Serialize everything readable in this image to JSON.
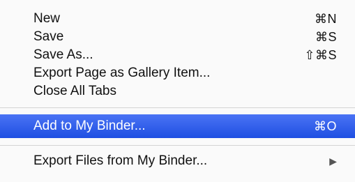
{
  "menu": {
    "items": [
      {
        "label": "New",
        "shortcut": "⌘N"
      },
      {
        "label": "Save",
        "shortcut": "⌘S"
      },
      {
        "label": "Save As...",
        "shortcut": "⇧⌘S"
      },
      {
        "label": "Export Page as Gallery Item..."
      },
      {
        "label": "Close All Tabs"
      },
      {
        "label": "Add to My Binder...",
        "shortcut": "⌘O"
      },
      {
        "label": "Export Files from My Binder...",
        "submenu_icon": "submenu-arrow-icon"
      }
    ],
    "colors": {
      "highlight": "#2f5fe9",
      "background": "#fafafa",
      "text": "#111111"
    }
  }
}
